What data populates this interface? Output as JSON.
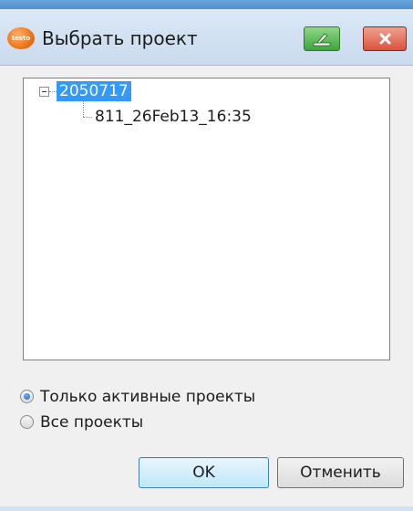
{
  "window": {
    "title": "Выбрать проект",
    "app_icon_text": "testo"
  },
  "tree": {
    "root": "2050717",
    "child": "811_26Feb13_16:35"
  },
  "options": {
    "active_only": "Только активные проекты",
    "all": "Все проекты",
    "selected": "active_only"
  },
  "buttons": {
    "ok": "OK",
    "cancel": "Отменить"
  },
  "colors": {
    "selection": "#3399ff",
    "close_button": "#d9533c",
    "green_button": "#3da53a"
  }
}
